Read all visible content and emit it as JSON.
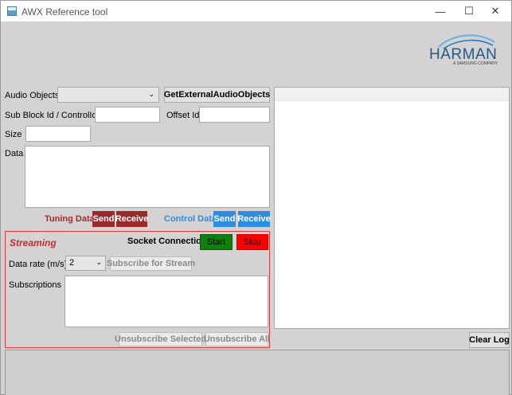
{
  "window": {
    "title": "AWX Reference tool",
    "controls": {
      "minimize": "—",
      "maximize": "☐",
      "close": "✕"
    }
  },
  "logo": {
    "brand": "HARMAN",
    "tagline": "A SAMSUNG COMPANY",
    "color": "#1e5a8c"
  },
  "form": {
    "audio_objects_label": "Audio Objects",
    "audio_objects_value": "",
    "get_external_button": "GetExternalAudioObjects",
    "sub_block_label": "Sub Block Id / ControlId",
    "sub_block_value": "",
    "offset_label": "Offset Id",
    "offset_value": "",
    "size_label": "Size",
    "size_value": "",
    "data_label": "Data",
    "data_value": ""
  },
  "tuning": {
    "label": "Tuning Data",
    "send": "Send",
    "receive": "Receive",
    "color": "#9b2b2b",
    "label_color": "#a52a2a"
  },
  "control": {
    "label": "Control Data",
    "send": "Send",
    "receive": "Receive",
    "color": "#2e8de0",
    "label_color": "#2e8de0"
  },
  "streaming": {
    "title": "Streaming",
    "socket_label": "Socket Connection",
    "start": "Start",
    "stop": "Stop",
    "start_color": "#0f7f0f",
    "stop_color": "#ff0000",
    "data_rate_label": "Data rate (m/s)",
    "data_rate_value": "2",
    "subscribe_button": "Subscribe for Stream",
    "subscriptions_label": "Subscriptions",
    "unsubscribe_selected": "Unsubscribe Selected",
    "unsubscribe_all": "Unsubscribe All"
  },
  "log": {
    "clear_button": "Clear Log"
  }
}
